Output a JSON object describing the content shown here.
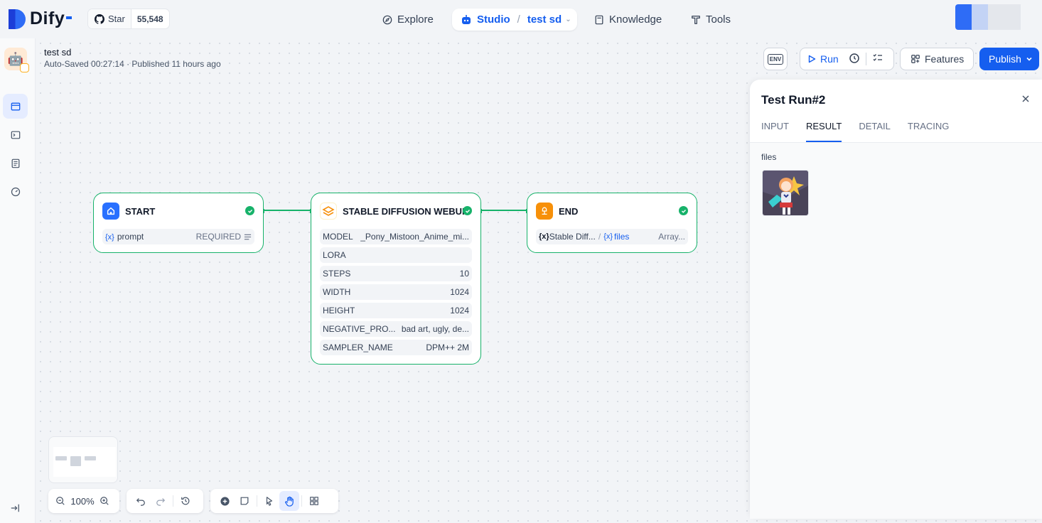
{
  "brand": {
    "name": "Dify"
  },
  "github": {
    "star_label": "Star",
    "star_count": "55,548"
  },
  "nav": {
    "explore": "Explore",
    "studio": "Studio",
    "app_name": "test sd",
    "knowledge": "Knowledge",
    "tools": "Tools"
  },
  "app": {
    "name": "test sd",
    "meta": "Auto-Saved 00:27:14 · Published 11 hours ago"
  },
  "toolbar": {
    "env_label": "ENV",
    "run_label": "Run",
    "features_label": "Features",
    "publish_label": "Publish"
  },
  "nodes": {
    "start": {
      "title": "START",
      "var_icon": "{x}",
      "var_name": "prompt",
      "var_required": "REQUIRED"
    },
    "sd": {
      "title": "STABLE DIFFUSION WEBUI",
      "rows": [
        {
          "key": "MODEL",
          "value": "_Pony_Mistoon_Anime_mi..."
        },
        {
          "key": "LORA",
          "value": ""
        },
        {
          "key": "STEPS",
          "value": "10"
        },
        {
          "key": "WIDTH",
          "value": "1024"
        },
        {
          "key": "HEIGHT",
          "value": "1024"
        },
        {
          "key": "NEGATIVE_PRO...",
          "value": "bad art, ugly, de..."
        },
        {
          "key": "SAMPLER_NAME",
          "value": "DPM++ 2M"
        }
      ]
    },
    "end": {
      "title": "END",
      "var_icon": "{x}",
      "source": "Stable Diff...",
      "var_sep": "/",
      "var_name": "files",
      "var_type": "Array..."
    }
  },
  "panel": {
    "title": "Test Run#2",
    "tabs": [
      "INPUT",
      "RESULT",
      "DETAIL",
      "TRACING"
    ],
    "active_tab": "RESULT",
    "files_label": "files"
  },
  "zoom": {
    "level": "100%"
  },
  "colors": {
    "accent": "#155eef",
    "success": "#17b26a",
    "end_node": "#f79009",
    "start_node": "#2970ff"
  }
}
